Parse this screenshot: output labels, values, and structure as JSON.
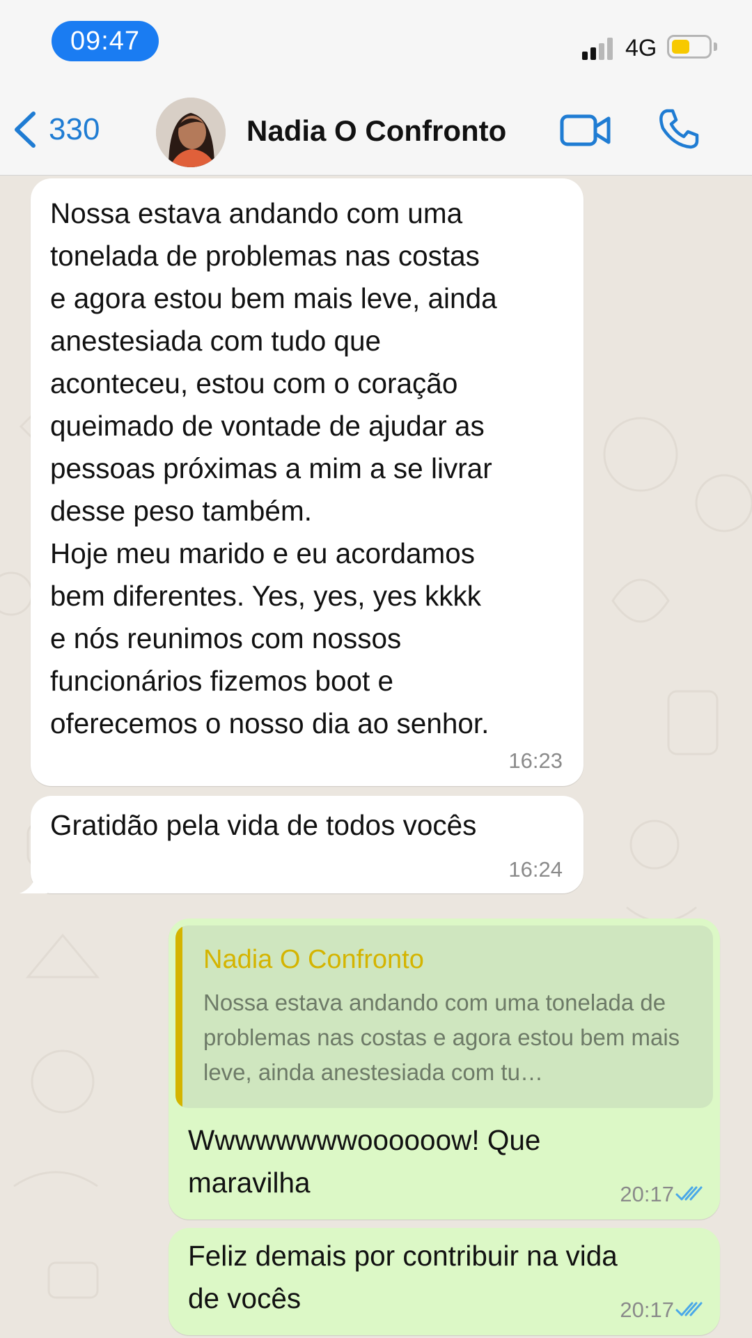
{
  "status_bar": {
    "time": "09:47",
    "network": "4G",
    "battery_level": 0.5,
    "signal_bars": 2,
    "colors": {
      "time_pill": "#1a7cf2",
      "battery": "#f7c900"
    }
  },
  "header": {
    "back_icon": "chevron-left-icon",
    "back_count": "330",
    "contact_name": "Nadia O Confronto",
    "video_icon": "video-camera-icon",
    "call_icon": "phone-icon",
    "accent_color": "#1f7cd3"
  },
  "messages": [
    {
      "direction": "incoming",
      "text": "Nossa estava andando com uma\ntonelada de problemas nas costas\ne agora estou bem mais leve, ainda\nanestesiada com tudo que\naconteceu, estou com o coração\nqueimado de vontade de ajudar as\npessoas próximas a mim a se livrar\ndesse peso também.\nHoje meu marido e eu acordamos\nbem diferentes. Yes, yes, yes kkkk\ne nós reunimos com nossos\nfuncionários fizemos boot e\noferecemos o nosso dia ao senhor.",
      "time": "16:23"
    },
    {
      "direction": "incoming",
      "text": "Gratidão pela vida de todos vocês",
      "time": "16:24"
    },
    {
      "direction": "outgoing",
      "quote": {
        "author": "Nadia O Confronto",
        "text": "Nossa estava andando com uma tonelada de problemas nas costas e agora estou bem mais leve, ainda anestesiada com tu…",
        "accent_color": "#d4b400"
      },
      "text": "Wwwwwwwwoooooow! Que\nmaravilha",
      "time": "20:17",
      "status_icon": "double-check-icon",
      "status_color": "#4aa8e8"
    },
    {
      "direction": "outgoing",
      "text": "Feliz demais por contribuir na vida\nde vocês",
      "time": "20:17",
      "status_icon": "double-check-icon",
      "status_color": "#4aa8e8"
    }
  ],
  "colors": {
    "chat_background": "#ebe6df",
    "incoming_bubble": "#ffffff",
    "outgoing_bubble": "#dcf8c6"
  }
}
